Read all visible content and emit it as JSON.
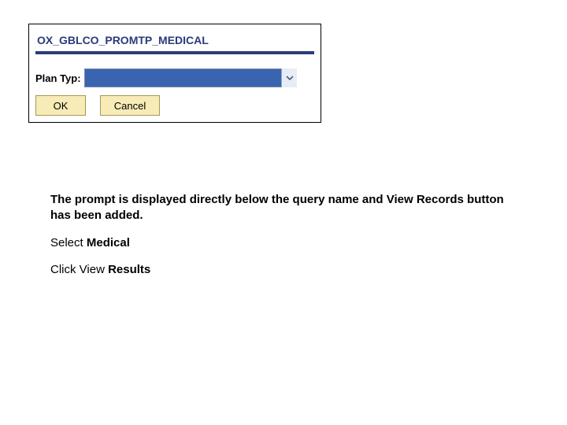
{
  "panel": {
    "query_title": "OX_GBLCO_PROMTP_MEDICAL",
    "field_label": "Plan Typ:",
    "select_value": "",
    "buttons": {
      "ok_label": "OK",
      "cancel_label": "Cancel"
    }
  },
  "instructions": {
    "line1_bold": "The prompt is displayed directly below the query name and View Records button has been added.",
    "line2_prefix": "Select ",
    "line2_bold": "Medical",
    "line3_prefix": "Click View ",
    "line3_bold": "Results"
  }
}
